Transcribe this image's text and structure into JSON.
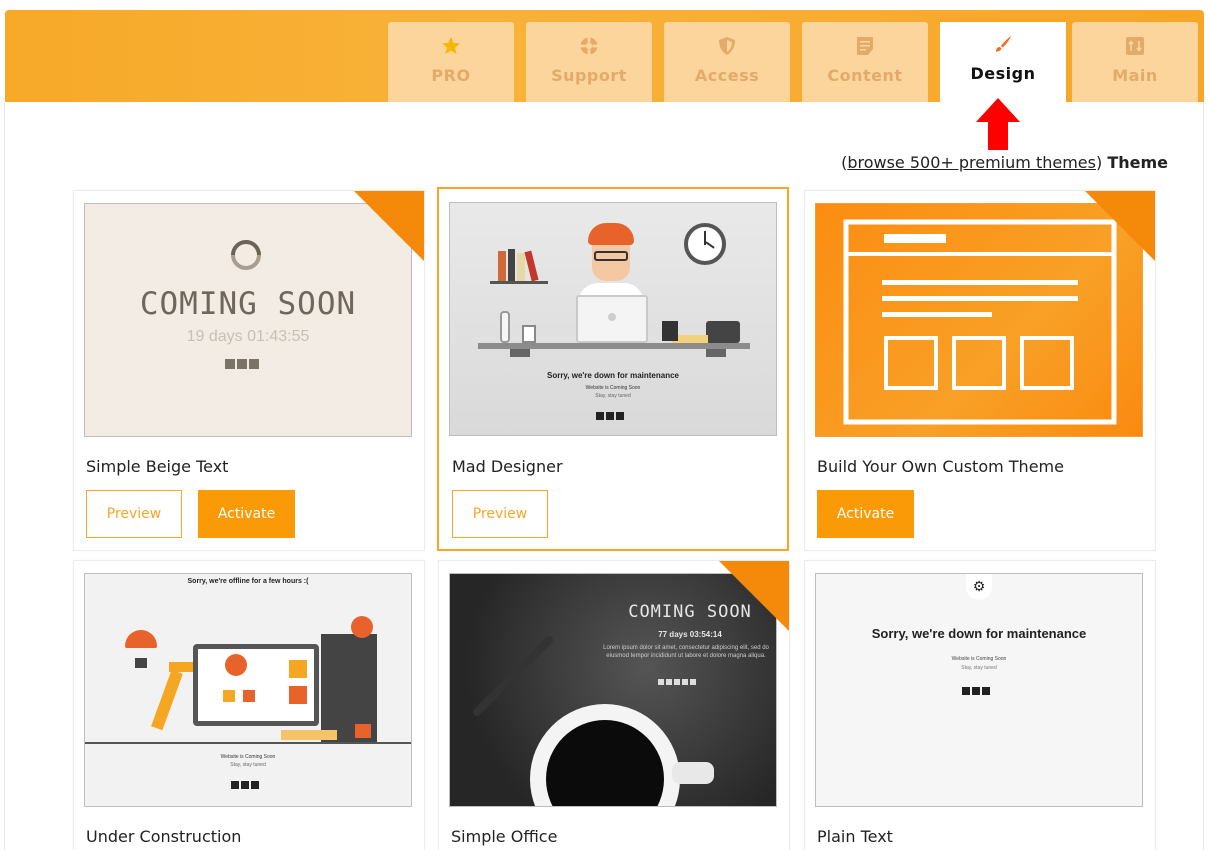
{
  "tabs": [
    {
      "label": "PRO",
      "icon": "star-icon"
    },
    {
      "label": "Support",
      "icon": "lifebuoy-icon"
    },
    {
      "label": "Access",
      "icon": "shield-icon"
    },
    {
      "label": "Content",
      "icon": "document-icon"
    },
    {
      "label": "Design",
      "icon": "paintbrush-icon",
      "active": true
    },
    {
      "label": "Main",
      "icon": "sliders-icon"
    }
  ],
  "browse": {
    "open_paren": "(",
    "link_text": "browse 500+ premium themes",
    "close_paren": ")",
    "theme_label": "Theme"
  },
  "cards": [
    {
      "title": "Simple Beige Text",
      "preview_label": "Preview",
      "activate_label": "Activate",
      "thumb": {
        "heading": "COMING SOON",
        "countdown": "19 days 01:43:55"
      }
    },
    {
      "title": "Mad Designer",
      "preview_label": "Preview",
      "thumb": {
        "heading": "Sorry, we're down for maintenance",
        "sub": "Website is Coming Soon",
        "sub2": "Stay, stay tuned"
      }
    },
    {
      "title": "Build Your Own Custom Theme",
      "activate_label": "Activate"
    },
    {
      "title": "Under Construction",
      "thumb": {
        "heading": "Sorry, we're offline for a few hours :(",
        "sub": "Website is Coming Soon",
        "sub2": "Stay, stay tuned"
      }
    },
    {
      "title": "Simple Office",
      "thumb": {
        "heading": "COMING SOON",
        "countdown": "77 days 03:54:14",
        "body": "Lorem ipsum dolor sit amet, consectetur adipiscing elit, sed do eiusmod tempor incididunt ut labore et dolore magna aliqua."
      }
    },
    {
      "title": "Plain Text",
      "thumb": {
        "heading": "Sorry, we're down for maintenance",
        "sub": "Website is Coming Soon",
        "sub2": "Stay, stay tuned"
      }
    }
  ],
  "colors": {
    "accent": "#f7a627",
    "accent_dark": "#fb9a07",
    "tab_inactive_bg": "#fbd59c",
    "tab_inactive_text": "#e2ab6a",
    "ribbon": "#f58a0a",
    "arrow": "#ff0000",
    "beige_bg": "#f3ece4"
  }
}
